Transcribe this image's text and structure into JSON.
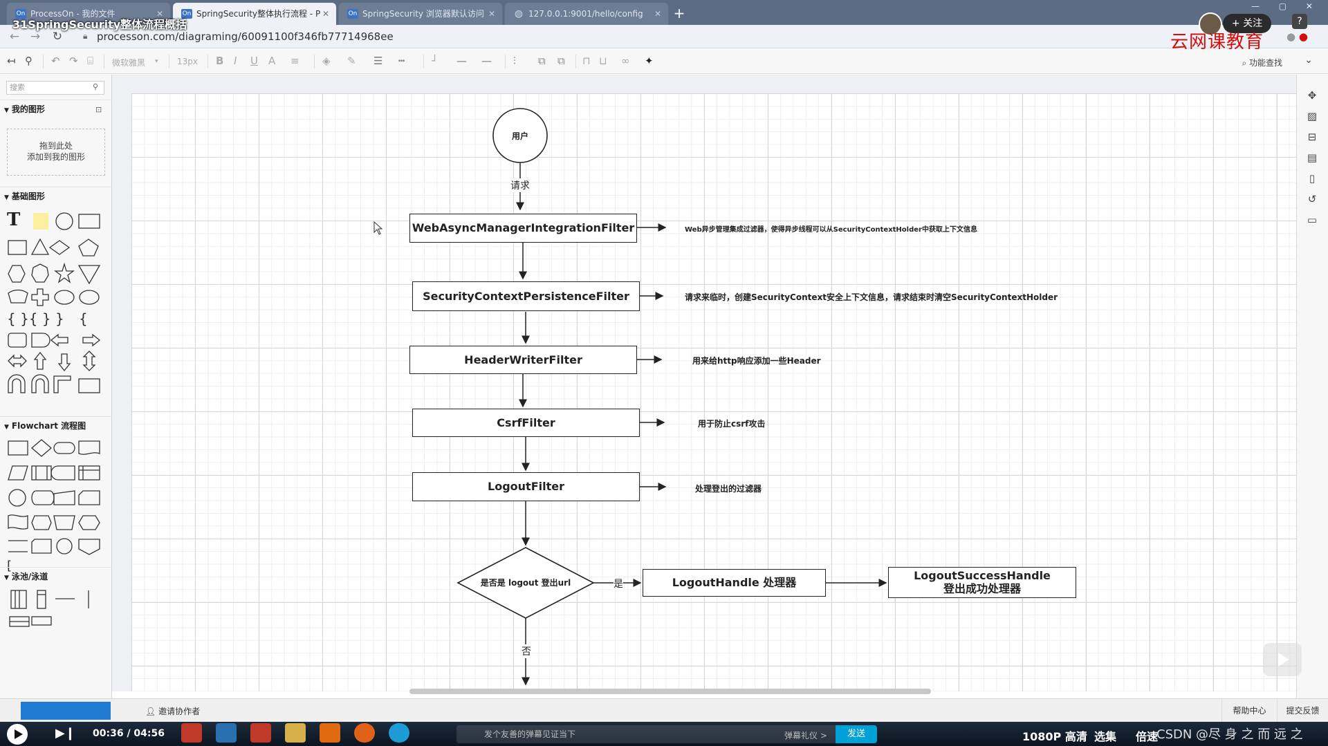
{
  "browser": {
    "tabs": [
      {
        "label": "ProcessOn - 我的文件",
        "favicon": "On"
      },
      {
        "label": "SpringSecurity整体执行流程 - P",
        "favicon": "On"
      },
      {
        "label": "SpringSecurity 浏览器默认访问",
        "favicon": "On"
      },
      {
        "label": "127.0.0.1:9001/hello/config",
        "favicon": "globe-icon"
      }
    ],
    "url": "processon.com/diagraming/60091100f346fb77714968ee"
  },
  "video": {
    "title": "31SpringSecurity整体流程概括",
    "follow_label": "+ 关注",
    "watermark": "云网课教育",
    "time": "00:36 / 04:56",
    "danmaku_placeholder": "发个友善的弹幕见证当下",
    "danmaku_etiquette": "弹幕礼仪 >",
    "send_label": "发送",
    "quality": "1080P 高清",
    "episodes": "选集",
    "speed": "倍速",
    "csdn_watermark": "CSDN @尽 身 之 而 远 之"
  },
  "toolbar": {
    "font_family": "微软雅黑",
    "font_size": "13px",
    "feature_search": "功能查找"
  },
  "left_panel": {
    "search_placeholder": "搜索",
    "my_shapes_title": "我的图形",
    "my_shapes_drop_line1": "拖到此处",
    "my_shapes_drop_line2": "添加到我的图形",
    "basic_shapes_title": "基础图形",
    "flowchart_title": "Flowchart 流程图",
    "swimlane_title": "泳池/泳道"
  },
  "diagram": {
    "start_label": "用户",
    "request_label": "请求",
    "filters": [
      {
        "name": "WebAsyncManagerIntegrationFilter",
        "desc": "Web异步管理集成过滤器，使得异步线程可以从SecurityContextHolder中获取上下文信息"
      },
      {
        "name": "SecurityContextPersistenceFilter",
        "desc": "请求来临时，创建SecurityContext安全上下文信息，请求结束时清空SecurityContextHolder"
      },
      {
        "name": "HeaderWriterFilter",
        "desc": "用来给http响应添加一些Header"
      },
      {
        "name": "CsrfFilter",
        "desc": "用于防止csrf攻击"
      },
      {
        "name": "LogoutFilter",
        "desc": "处理登出的过滤器"
      }
    ],
    "decision_label": "是否是 logout 登出url",
    "yes_label": "是",
    "no_label": "否",
    "logout_handler": "LogoutHandle 处理器",
    "logout_success_line1": "LogoutSuccessHandle",
    "logout_success_line2": "登出成功处理器"
  },
  "status_bar": {
    "invite_label": "邀请协作者",
    "help_center": "帮助中心",
    "feedback": "提交反馈"
  },
  "colors": {
    "tabbar": "#5b6c83",
    "accent_blue": "#1f7ad1",
    "send_blue": "#00a1d6",
    "watermark_red": "#d40e0e"
  }
}
